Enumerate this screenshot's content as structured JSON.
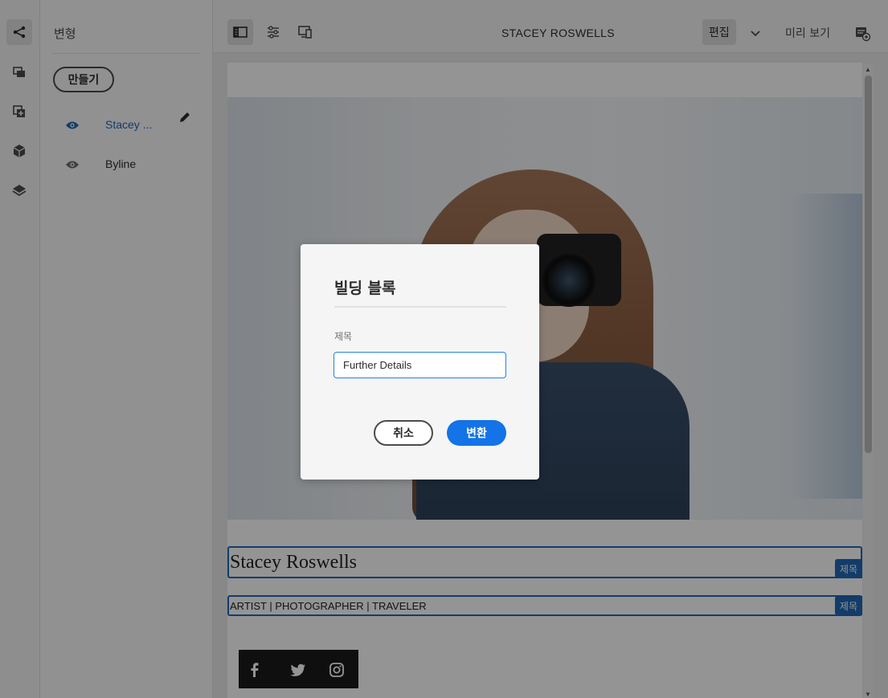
{
  "panel": {
    "title": "변형",
    "create_label": "만들기",
    "variations": [
      {
        "label": "Stacey ...",
        "selected": true
      },
      {
        "label": "Byline",
        "selected": false
      }
    ]
  },
  "toolbar": {
    "page_title": "STACEY ROSWELLS",
    "edit_label": "편집",
    "preview_label": "미리 보기"
  },
  "content": {
    "name": "Stacey Roswells",
    "tagline": "ARTIST | PHOTOGRAPHER | TRAVELER",
    "component_badge": "제목"
  },
  "dialog": {
    "title": "빌딩 블록",
    "field_label": "제목",
    "field_value": "Further Details",
    "cancel_label": "취소",
    "convert_label": "변환"
  },
  "colors": {
    "accent": "#1473e6",
    "selection": "#2068b5",
    "overlay": "rgba(0,0,0,0.42)"
  }
}
